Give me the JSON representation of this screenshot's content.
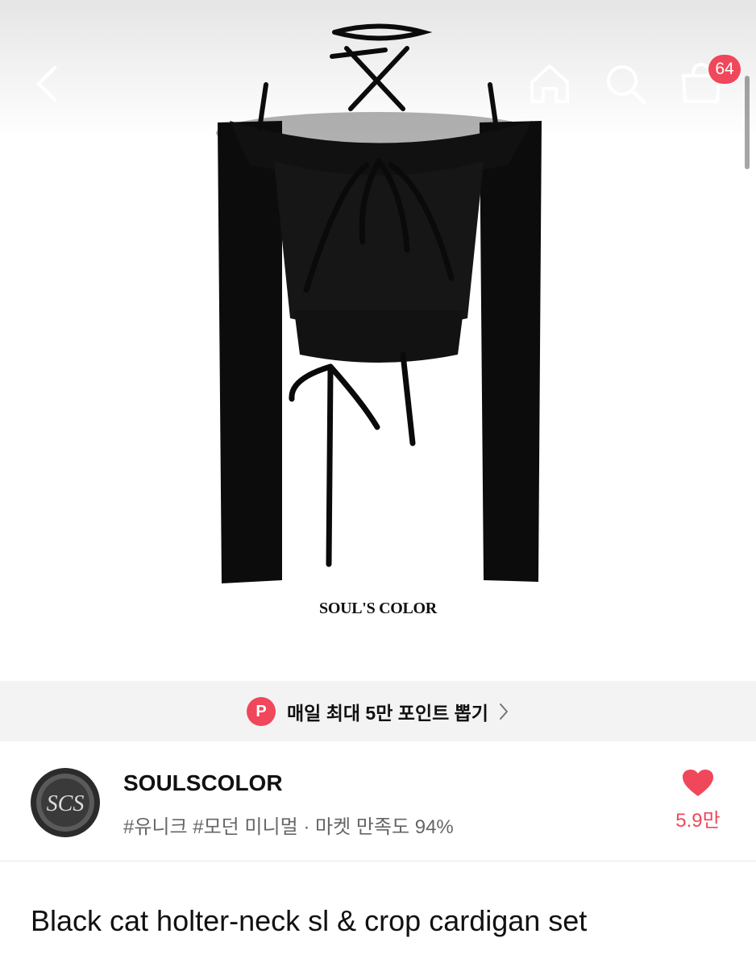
{
  "header": {
    "back_icon": "chevron-left-icon",
    "home_icon": "home-icon",
    "search_icon": "search-icon",
    "cart_icon": "shopping-bag-icon",
    "cart_badge": "64"
  },
  "hero": {
    "brand_watermark": "SOUL'S COLOR"
  },
  "point_banner": {
    "icon_letter": "P",
    "text": "매일 최대 5만 포인트 뽑기"
  },
  "seller": {
    "name": "SOULSCOLOR",
    "tags": "#유니크 #모던 미니멀 · 마켓 만족도 94%",
    "like_count": "5.9만"
  },
  "product": {
    "title": "Black cat holter-neck sl & crop cardigan set"
  },
  "colors": {
    "accent": "#f0475a",
    "banner_bg": "#f3f3f4",
    "garment": "#0c0c0c"
  }
}
